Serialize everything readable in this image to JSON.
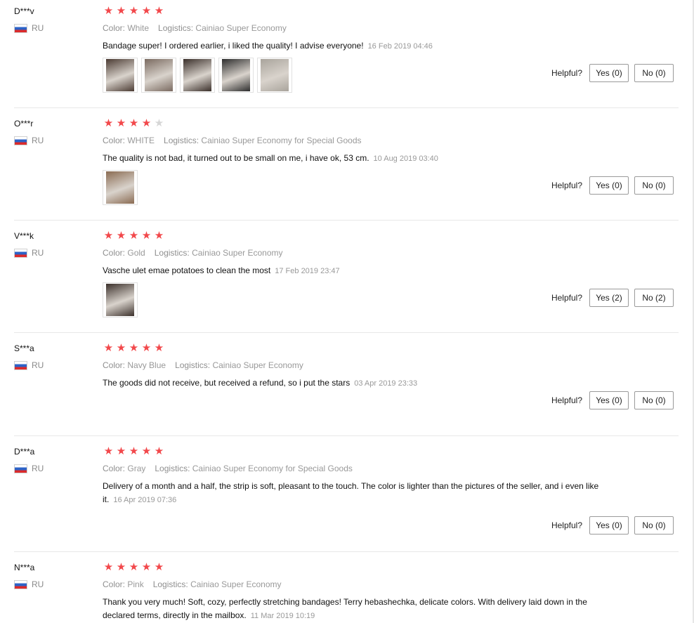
{
  "helpful_label": "Helpful?",
  "star_glyph": "★",
  "colors": {
    "star_active": "#f2484b",
    "star_inactive": "#d6d6d6"
  },
  "reviews": [
    {
      "user": "D***v",
      "country": "RU",
      "rating": 5,
      "color_label": "Color:",
      "color": "White",
      "logistics_label": "Logistics:",
      "logistics": "Cainiao Super Economy",
      "text": "Bandage super! I ordered earlier, i liked the quality! I advise everyone!",
      "date": "16 Feb 2019 04:46",
      "photos": 5,
      "yes": "Yes (0)",
      "no": "No (0)"
    },
    {
      "user": "O***r",
      "country": "RU",
      "rating": 4,
      "color_label": "Color:",
      "color": "WHITE",
      "logistics_label": "Logistics:",
      "logistics": "Cainiao Super Economy for Special Goods",
      "text": "The quality is not bad, it turned out to be small on me, i have ok, 53 cm.",
      "date": "10 Aug 2019 03:40",
      "photos": 1,
      "yes": "Yes (0)",
      "no": "No (0)"
    },
    {
      "user": "V***k",
      "country": "RU",
      "rating": 5,
      "color_label": "Color:",
      "color": "Gold",
      "logistics_label": "Logistics:",
      "logistics": "Cainiao Super Economy",
      "text": "Vasche ulet emae potatoes to clean the most",
      "date": "17 Feb 2019 23:47",
      "photos": 1,
      "yes": "Yes (2)",
      "no": "No (2)"
    },
    {
      "user": "S***a",
      "country": "RU",
      "rating": 5,
      "color_label": "Color:",
      "color": "Navy Blue",
      "logistics_label": "Logistics:",
      "logistics": "Cainiao Super Economy",
      "text": "The goods did not receive, but received a refund, so i put the stars",
      "date": "03 Apr 2019 23:33",
      "photos": 0,
      "yes": "Yes (0)",
      "no": "No (0)"
    },
    {
      "user": "D***a",
      "country": "RU",
      "rating": 5,
      "color_label": "Color:",
      "color": "Gray",
      "logistics_label": "Logistics:",
      "logistics": "Cainiao Super Economy for Special Goods",
      "text": "Delivery of a month and a half, the strip is soft, pleasant to the touch. The color is lighter than the pictures of the seller, and i even like it.",
      "date": "16 Apr 2019 07:36",
      "photos": 0,
      "yes": "Yes (0)",
      "no": "No (0)"
    },
    {
      "user": "N***a",
      "country": "RU",
      "rating": 5,
      "color_label": "Color:",
      "color": "Pink",
      "logistics_label": "Logistics:",
      "logistics": "Cainiao Super Economy",
      "text": "Thank you very much! Soft, cozy, perfectly stretching bandages! Terry hebashechka, delicate colors. With delivery laid down in the declared terms, directly in the mailbox.",
      "date": "11 Mar 2019 10:19",
      "photos": 0,
      "yes": null,
      "no": null
    }
  ]
}
